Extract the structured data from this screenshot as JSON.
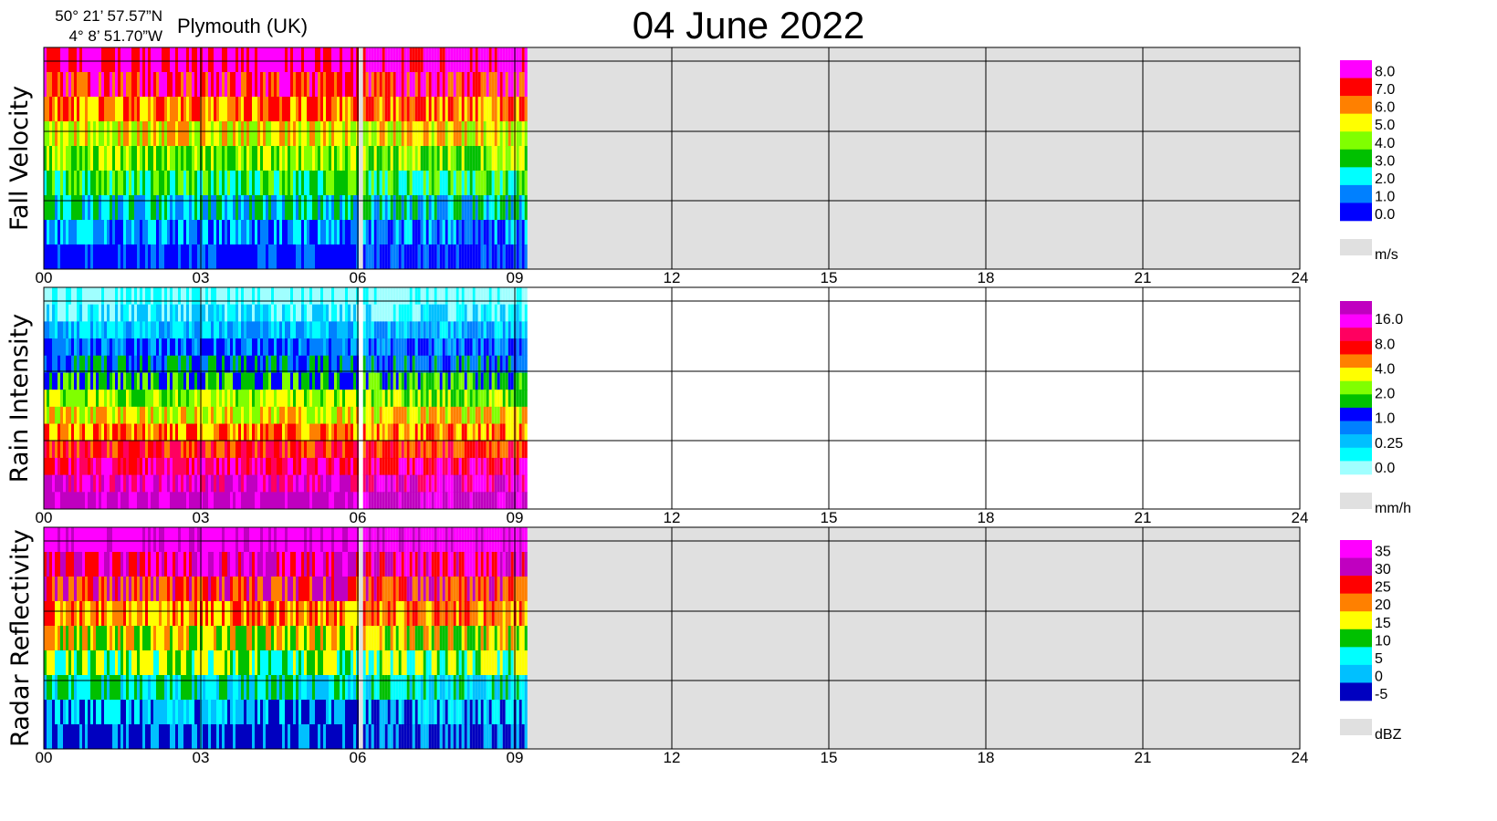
{
  "header": {
    "coord_lat": "50° 21’ 57.57”N",
    "coord_lon": "4°  8’ 51.70”W",
    "location": "Plymouth (UK)",
    "date": "04 June  2022"
  },
  "chart_data": [
    {
      "type": "heatmap",
      "panel": "fall-velocity",
      "ylabel": "Fall Velocity",
      "xlim": [
        0,
        24
      ],
      "x_ticks": [
        "00",
        "03",
        "06",
        "09",
        "12",
        "15",
        "18",
        "21",
        "24"
      ],
      "active_segments": [
        [
          0.0,
          6.0
        ],
        [
          6.1,
          9.2
        ]
      ],
      "colorbar": {
        "unit": "m/s",
        "labels": [
          "8.0",
          "7.0",
          "6.0",
          "5.0",
          "4.0",
          "3.0",
          "2.0",
          "1.0",
          "0.0"
        ],
        "colors": [
          "#ff00ff",
          "#ff0000",
          "#ff8000",
          "#ffff00",
          "#80ff00",
          "#00c000",
          "#00ffff",
          "#0080ff",
          "#0000ff"
        ],
        "nodata_color": "#e0e0e0"
      }
    },
    {
      "type": "heatmap",
      "panel": "rain-intensity",
      "ylabel": "Rain Intensity",
      "xlim": [
        0,
        24
      ],
      "x_ticks": [
        "00",
        "03",
        "06",
        "09",
        "12",
        "15",
        "18",
        "21",
        "24"
      ],
      "active_segments": [
        [
          0.0,
          6.0
        ],
        [
          6.1,
          9.2
        ]
      ],
      "colorbar": {
        "unit": "mm/h",
        "labels": [
          "16.0",
          "8.0",
          "4.0",
          "2.0",
          "1.0",
          "0.25",
          "0.0"
        ],
        "colors": [
          "#c000c0",
          "#ff00ff",
          "#ff0060",
          "#ff0000",
          "#ff8000",
          "#ffff00",
          "#80ff00",
          "#00c000",
          "#0000ff",
          "#0080ff",
          "#00c0ff",
          "#00ffff",
          "#a0ffff"
        ],
        "nodata_color": "#e0e0e0"
      }
    },
    {
      "type": "heatmap",
      "panel": "radar-reflectivity",
      "ylabel": "Radar Reflectivity",
      "xlim": [
        0,
        24
      ],
      "x_ticks": [
        "00",
        "03",
        "06",
        "09",
        "12",
        "15",
        "18",
        "21",
        "24"
      ],
      "active_segments": [
        [
          0.0,
          6.0
        ],
        [
          6.1,
          9.2
        ]
      ],
      "colorbar": {
        "unit": "dBZ",
        "labels": [
          "35",
          "30",
          "25",
          "20",
          "15",
          "10",
          "5",
          "0",
          "-5"
        ],
        "colors": [
          "#ff00ff",
          "#c000c0",
          "#ff0000",
          "#ff8000",
          "#ffff00",
          "#00c000",
          "#00ffff",
          "#00c0ff",
          "#0000c0"
        ],
        "nodata_color": "#e0e0e0"
      }
    }
  ]
}
